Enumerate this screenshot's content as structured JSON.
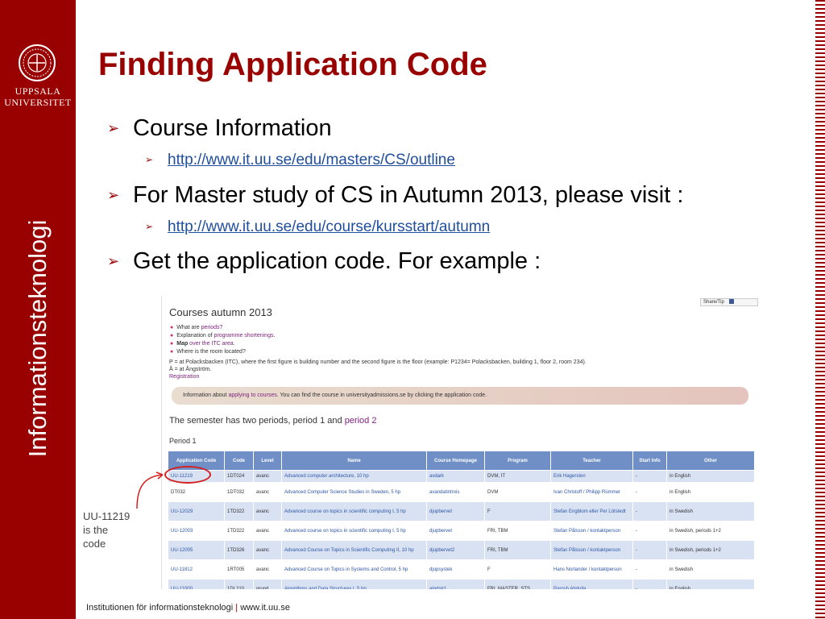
{
  "slide": {
    "title": "Finding Application Code",
    "university": {
      "line1": "UPPSALA",
      "line2": "UNIVERSITET"
    },
    "vertical_label": "Informationsteknologi",
    "bullets": [
      {
        "text": "Course Information",
        "link": "http://www.it.uu.se/edu/masters/CS/outline"
      },
      {
        "text": "For Master study of CS in Autumn 2013, please visit :",
        "link": "http://www.it.uu.se/edu/course/kursstart/autumn"
      },
      {
        "text": "Get the application code. For example :"
      }
    ],
    "annotation": {
      "line1": "UU-11219",
      "line2": "is the",
      "line3": "code"
    },
    "footer": {
      "dept": "Institutionen för informationsteknologi",
      "sep": "|",
      "url": "www.it.uu.se"
    },
    "colors": {
      "brand": "#990000",
      "table_header": "#6f8fc6",
      "link": "#1f4e9c"
    }
  },
  "screenshot": {
    "share_label": "Share/Tip",
    "heading": "Courses autumn 2013",
    "list": [
      {
        "pre": "What are ",
        "link": "periods?",
        "post": ""
      },
      {
        "pre": "Explanation of ",
        "link": "programme shortenings",
        "post": "."
      },
      {
        "pre": "Map",
        "link": " over the ITC area",
        "post": "."
      },
      {
        "pre": "Where is the room located?",
        "link": "",
        "post": ""
      }
    ],
    "note1": "P = at Polacksbacken (ITC), where the first figure is building number and the second figure is the floor (example: P1234= Polacksbacken, building 1, floor 2, room 234).",
    "note2": "Å = at Ångström.",
    "registration": "Registration",
    "info": {
      "pre": "Information about ",
      "link": "applying to courses",
      "post": ". You can find the course in universityadmissions.se by clicking the application code."
    },
    "semester": {
      "pre": "The semester has two periods, period 1 and ",
      "link": "period 2"
    },
    "period": "Period 1",
    "columns": [
      "Application Code",
      "Code",
      "Level",
      "Name",
      "Course Homepage",
      "Program",
      "Teacher",
      "Start Info",
      "Other"
    ],
    "rows": [
      [
        "UU-11219",
        "1DT024",
        "avanc",
        "Advanced computer architecture, 10 hp",
        "avdark",
        "DVM, IT",
        "Erik Hagersten",
        "-",
        "in English"
      ],
      [
        "DT032",
        "1DT032",
        "avanc",
        "Advanced Computer Science Studies in Sweden, 5 hp",
        "avandatintrois",
        "DVM",
        "Ivan Christoff / Philipp Rümmer",
        "-",
        "in English"
      ],
      [
        "UU-12029",
        "1TD322",
        "avanc",
        "Advanced course on topics in scientific computing I, 5 hp",
        "djupbervet",
        "F",
        "Stefan Engblom eller Per Lötstedt",
        "-",
        "in Swedish"
      ],
      [
        "UU-12003",
        "1TD322",
        "avanc",
        "Advanced course on topics in scientific computing I, 5 hp",
        "djupbervet",
        "FRI, TBM",
        "Stefan Pålsson / kontaktperson",
        "-",
        "in Swedish, periods 1+2"
      ],
      [
        "UU-12005",
        "1TD326",
        "avanc",
        "Advanced Course on Topics in Scientific Computing II, 10 hp",
        "djupbervet2",
        "FRI, TBM",
        "Stefan Pålsson / kontaktperson",
        "-",
        "in Swedish, periods 1+2"
      ],
      [
        "UU-11812",
        "1RT005",
        "avanc",
        "Advanced Course on Topics in Systems and Control, 5 hp",
        "djupsystek",
        "F",
        "Hans Norlander / kontaktperson",
        "-",
        "in Swedish"
      ],
      [
        "UU-11000",
        "1DL210",
        "grund",
        "Algorithms and Data Structures I, 5 hp",
        "algdstr1",
        "FRI, MASTER, STS",
        "Parosh Abdulla",
        "-",
        "in English"
      ]
    ]
  }
}
